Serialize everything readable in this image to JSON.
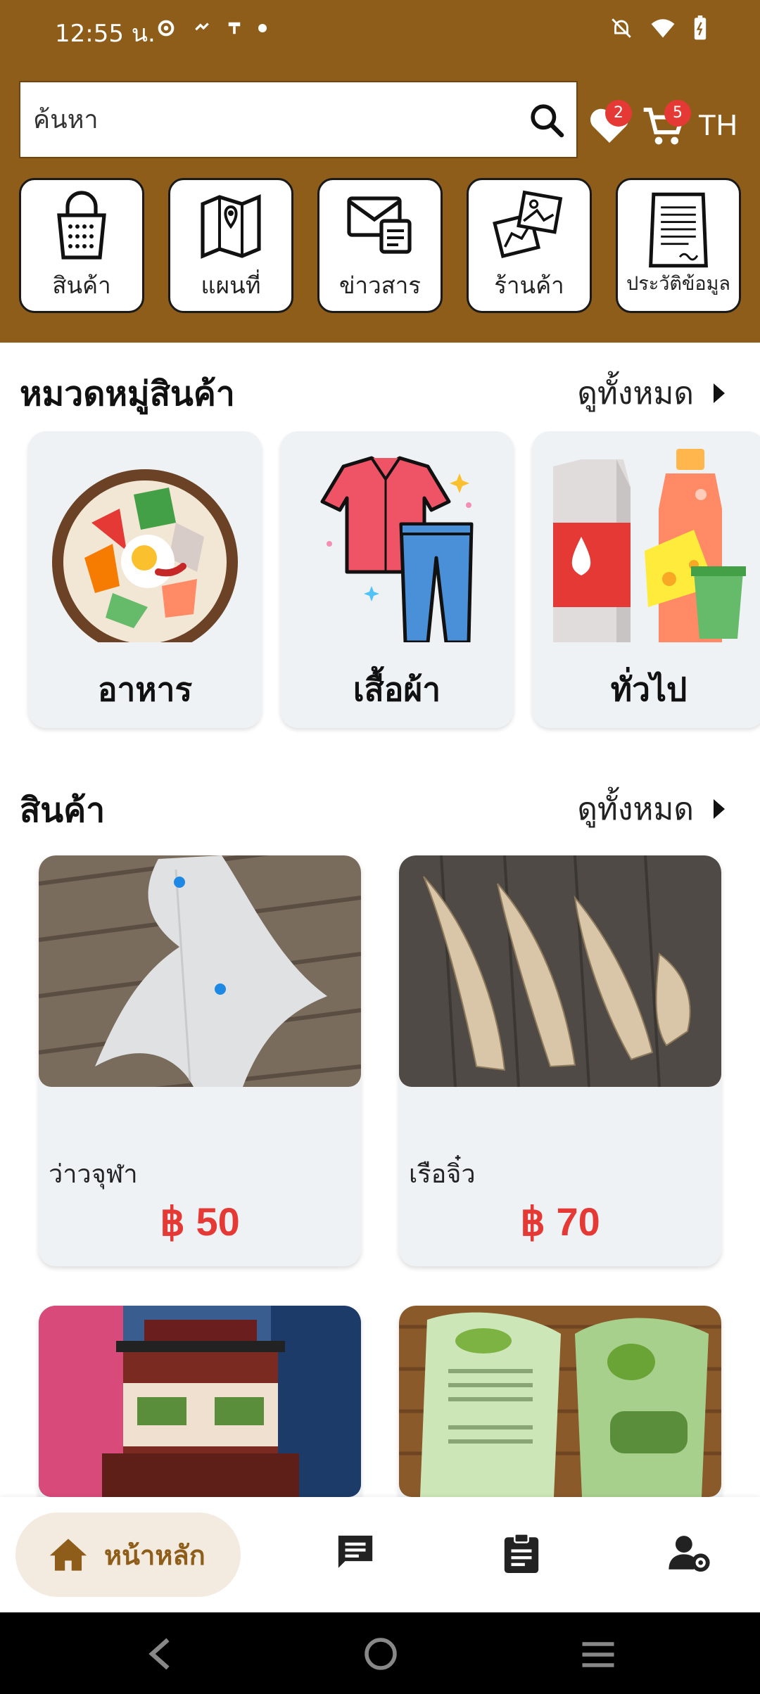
{
  "status": {
    "time": "12:55 น."
  },
  "search": {
    "placeholder": "ค้นหา"
  },
  "header": {
    "wishlist_count": "2",
    "cart_count": "5",
    "language": "TH"
  },
  "menu": [
    {
      "label": "สินค้า",
      "icon": "shopping-bag-icon"
    },
    {
      "label": "แผนที่",
      "icon": "map-icon"
    },
    {
      "label": "ข่าวสาร",
      "icon": "mail-news-icon"
    },
    {
      "label": "ร้านค้า",
      "icon": "photos-icon"
    },
    {
      "label": "ประวัติข้อมูล",
      "icon": "document-icon"
    }
  ],
  "categories": {
    "title": "หมวดหมู่สินค้า",
    "see_all": "ดูทั้งหมด",
    "items": [
      {
        "label": "อาหาร"
      },
      {
        "label": "เสื้อผ้า"
      },
      {
        "label": "ทั่วไป"
      }
    ]
  },
  "products": {
    "title": "สินค้า",
    "see_all": "ดูทั้งหมด",
    "items": [
      {
        "name": "ว่าวจุฬา",
        "price": "฿ 50"
      },
      {
        "name": "เรือจิ๋ว",
        "price": "฿ 70"
      },
      {
        "name": "",
        "price": ""
      },
      {
        "name": "",
        "price": ""
      }
    ]
  },
  "bottom_nav": {
    "home_label": "หน้าหลัก"
  },
  "colors": {
    "brand": "#8f5d1a",
    "price": "#e53935",
    "card": "#eef2f5"
  }
}
